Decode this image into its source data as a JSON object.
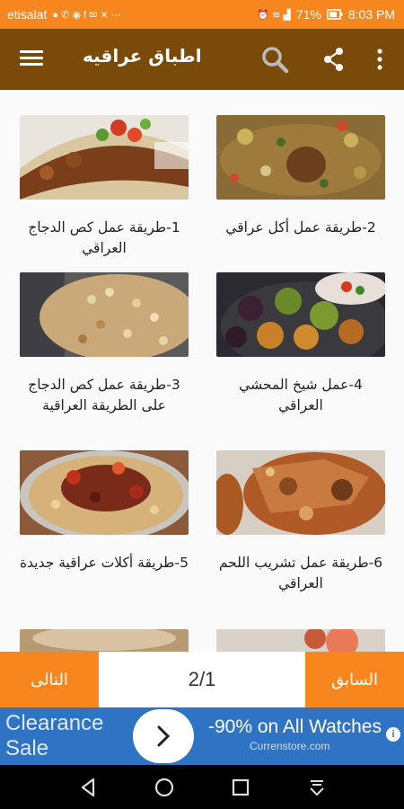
{
  "status_bar": {
    "carrier": "etisalat",
    "battery": "71%",
    "time": "8:03 PM",
    "color": "#f7861e"
  },
  "toolbar": {
    "title": "اطباق عراقيه",
    "color": "#7a4a08",
    "icons": [
      "menu-icon",
      "search-icon",
      "share-icon",
      "more-icon"
    ]
  },
  "recipes": [
    {
      "title": "2-طريقة عمل أكل عراقي"
    },
    {
      "title": "1-طريقة عمل كص الدجاج العراقي"
    },
    {
      "title": "4-عمل شيخ المحشي العراقي"
    },
    {
      "title": "3-طريقة عمل كص الدجاج على الطريقة العراقية"
    },
    {
      "title": "6-طريقة عمل تشريب اللحم العراقي"
    },
    {
      "title": "5-طريقة أكلات عراقية جديدة"
    }
  ],
  "pagination": {
    "previous_label": "السابق",
    "next_label": "التالى",
    "page_indicator": "2/1"
  },
  "ad": {
    "left_text": "Clearance Sale",
    "offer": "-90% on All Watches",
    "site": "Currenstore.com",
    "color": "#2e73c4"
  },
  "accent_color": "#f7861e"
}
